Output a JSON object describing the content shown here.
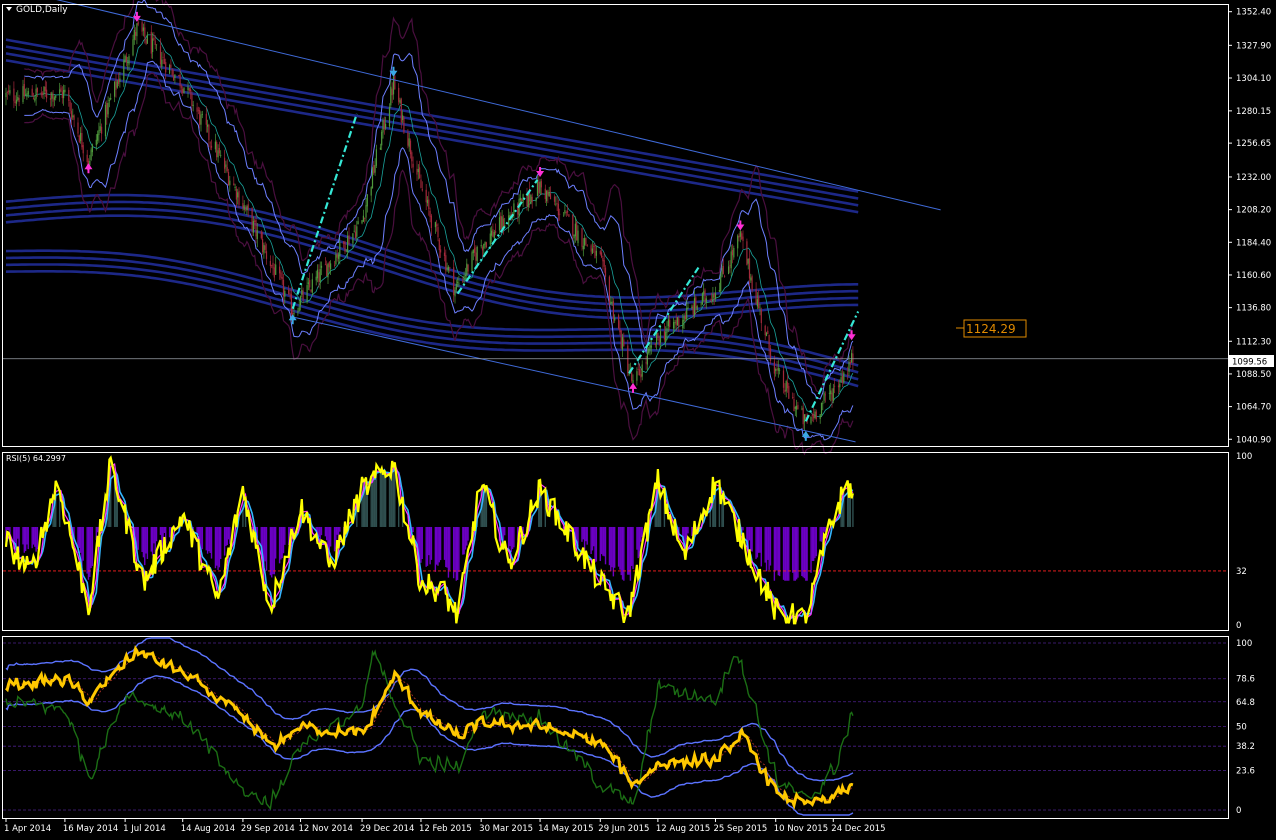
{
  "window": {
    "title": "GOLD,Daily",
    "triangle_icon": "dropdown-triangle-icon"
  },
  "colors": {
    "background": "#000000",
    "frame": "#ffffff",
    "axis_text": "#ffffff",
    "channel_line": "#3f6ad8",
    "envelope_band": "#1f2a8f",
    "bollinger": "#6d7fff",
    "dark_band": "#4a0f3f",
    "candle_up": "#4f9a3c",
    "candle_down": "#a2293b",
    "trend_dash": "#35e8d6",
    "arrow_magenta": "#ff2fd6",
    "arrow_blue": "#3aa9e6",
    "price_label": "#e08a00",
    "rsi_yellow": "#ffff00",
    "rsi_cyan": "#34b6ff",
    "rsi_magenta": "#ff33ff",
    "rsi_hist_purple": "#6b00c4",
    "rsi_hist_gray": "#2f4f4f",
    "rsi_level": "#ff2020",
    "stoch_yellow": "#ffc800",
    "stoch_green": "#1b6e14",
    "stoch_band": "#5b73ff",
    "fib_level": "#4b1f8a"
  },
  "chart_data": [
    {
      "type": "candlestick",
      "title": "GOLD,Daily",
      "xlabel": "",
      "ylabel": "",
      "ylim": [
        1036,
        1358
      ],
      "y_ticks": [
        "1352.40",
        "1327.90",
        "1304.10",
        "1280.15",
        "1256.65",
        "1232.00",
        "1208.20",
        "1184.40",
        "1160.60",
        "1136.80",
        "1112.30",
        "1088.50",
        "1064.70",
        "1040.90"
      ],
      "current_price": "1099.56",
      "annotation_price": "1124.29",
      "x_ticks": [
        "1 Apr 2014",
        "16 May 2014",
        "1 Jul 2014",
        "14 Aug 2014",
        "29 Sep 2014",
        "12 Nov 2014",
        "29 Dec 2014",
        "12 Feb 2015",
        "30 Mar 2015",
        "14 May 2015",
        "29 Jun 2015",
        "12 Aug 2015",
        "25 Sep 2015",
        "10 Nov 2015",
        "24 Dec 2015"
      ],
      "anchors": [
        {
          "date": "1 Apr 2014",
          "close": 1291
        },
        {
          "date": "16 May 2014",
          "close": 1293
        },
        {
          "date": "3 Jun 2014",
          "close": 1244
        },
        {
          "date": "10 Jul 2014",
          "close": 1340
        },
        {
          "date": "14 Aug 2014",
          "close": 1300
        },
        {
          "date": "29 Sep 2014",
          "close": 1212
        },
        {
          "date": "6 Nov 2014",
          "close": 1135
        },
        {
          "date": "29 Dec 2014",
          "close": 1200
        },
        {
          "date": "22 Jan 2015",
          "close": 1300
        },
        {
          "date": "12 Feb 2015",
          "close": 1224
        },
        {
          "date": "10 Mar 2015",
          "close": 1150
        },
        {
          "date": "30 Mar 2015",
          "close": 1183
        },
        {
          "date": "14 May 2015",
          "close": 1225
        },
        {
          "date": "29 Jun 2015",
          "close": 1171
        },
        {
          "date": "24 Jul 2015",
          "close": 1080
        },
        {
          "date": "12 Aug 2015",
          "close": 1115
        },
        {
          "date": "25 Sep 2015",
          "close": 1150
        },
        {
          "date": "14 Oct 2015",
          "close": 1188
        },
        {
          "date": "10 Nov 2015",
          "close": 1090
        },
        {
          "date": "3 Dec 2015",
          "close": 1052
        },
        {
          "date": "24 Dec 2015",
          "close": 1077
        },
        {
          "date": "8 Jan 2016",
          "close": 1099.56
        }
      ],
      "markers": [
        {
          "date": "10 Jul 2014",
          "price": 1345,
          "kind": "down-arrow",
          "color": "magenta"
        },
        {
          "date": "3 Jun 2014",
          "price": 1242,
          "kind": "up-arrow",
          "color": "magenta"
        },
        {
          "date": "6 Nov 2014",
          "price": 1132,
          "kind": "up-arrow",
          "color": "blue"
        },
        {
          "date": "22 Jan 2015",
          "price": 1305,
          "kind": "down-arrow",
          "color": "blue"
        },
        {
          "date": "14 May 2015",
          "price": 1232,
          "kind": "down-arrow",
          "color": "magenta"
        },
        {
          "date": "14 Oct 2015",
          "price": 1193,
          "kind": "down-arrow",
          "color": "magenta"
        },
        {
          "date": "24 Jul 2015",
          "price": 1082,
          "kind": "up-arrow",
          "color": "magenta"
        },
        {
          "date": "3 Dec 2015",
          "price": 1047,
          "kind": "up-arrow",
          "color": "blue"
        },
        {
          "date": "7 Jan 2016",
          "price": 1113,
          "kind": "down-arrow",
          "color": "magenta"
        }
      ],
      "trend_dashes": [
        {
          "from": {
            "date": "6 Nov 2014",
            "price": 1136
          },
          "to": {
            "date": "25 Dec 2014",
            "price": 1278
          }
        },
        {
          "from": {
            "date": "12 Mar 2015",
            "price": 1147
          },
          "to": {
            "date": "12 May 2015",
            "price": 1230
          }
        },
        {
          "from": {
            "date": "21 Jul 2015",
            "price": 1089
          },
          "to": {
            "date": "12 Sep 2015",
            "price": 1166
          }
        },
        {
          "from": {
            "date": "3 Dec 2015",
            "price": 1054
          },
          "to": {
            "date": "12 Jan 2016",
            "price": 1134
          }
        }
      ],
      "channel_lines": [
        {
          "from": {
            "date": "1 Apr 2014",
            "price": 1370
          },
          "to": {
            "date": "15 Mar 2016",
            "price": 1208
          }
        },
        {
          "from": {
            "date": "6 Nov 2014",
            "price": 1130
          },
          "to": {
            "date": "10 Jan 2016",
            "price": 1039
          }
        }
      ]
    },
    {
      "type": "line",
      "title": "RSI(5) 64.2997",
      "ylim": [
        0,
        100
      ],
      "y_ticks": [
        "100",
        "32",
        "0"
      ],
      "level": 32,
      "mid_level": 58,
      "anchors": [
        {
          "date": "1 Apr 2014",
          "value": 50
        },
        {
          "date": "20 Apr 2014",
          "value": 30
        },
        {
          "date": "10 May 2014",
          "value": 85
        },
        {
          "date": "3 Jun 2014",
          "value": 10
        },
        {
          "date": "20 Jun 2014",
          "value": 95
        },
        {
          "date": "15 Jul 2014",
          "value": 25
        },
        {
          "date": "14 Aug 2014",
          "value": 65
        },
        {
          "date": "10 Sep 2014",
          "value": 15
        },
        {
          "date": "29 Sep 2014",
          "value": 80
        },
        {
          "date": "20 Oct 2014",
          "value": 10
        },
        {
          "date": "12 Nov 2014",
          "value": 70
        },
        {
          "date": "5 Dec 2014",
          "value": 35
        },
        {
          "date": "29 Dec 2014",
          "value": 80
        },
        {
          "date": "22 Jan 2015",
          "value": 95
        },
        {
          "date": "12 Feb 2015",
          "value": 25
        },
        {
          "date": "1 Mar 2015",
          "value": 20
        },
        {
          "date": "12 Mar 2015",
          "value": 5
        },
        {
          "date": "30 Mar 2015",
          "value": 85
        },
        {
          "date": "20 Apr 2015",
          "value": 35
        },
        {
          "date": "14 May 2015",
          "value": 80
        },
        {
          "date": "29 Jun 2015",
          "value": 25
        },
        {
          "date": "20 Jul 2015",
          "value": 5
        },
        {
          "date": "12 Aug 2015",
          "value": 85
        },
        {
          "date": "1 Sep 2015",
          "value": 40
        },
        {
          "date": "25 Sep 2015",
          "value": 85
        },
        {
          "date": "10 Nov 2015",
          "value": 8
        },
        {
          "date": "3 Dec 2015",
          "value": 3
        },
        {
          "date": "20 Dec 2015",
          "value": 55
        },
        {
          "date": "4 Jan 2016",
          "value": 85
        },
        {
          "date": "11 Jan 2016",
          "value": 64.3
        }
      ]
    },
    {
      "type": "line",
      "title": "",
      "ylim": [
        -5,
        105
      ],
      "y_ticks": [
        "100",
        "78.6",
        "64.8",
        "50",
        "38.2",
        "23.6",
        "0"
      ],
      "levels": [
        100,
        78.6,
        64.8,
        50,
        38.2,
        23.6,
        0
      ],
      "yellow_anchors": [
        {
          "date": "1 Apr 2014",
          "value": 75
        },
        {
          "date": "16 May 2014",
          "value": 78
        },
        {
          "date": "3 Jun 2014",
          "value": 65
        },
        {
          "date": "1 Jul 2014",
          "value": 90
        },
        {
          "date": "10 Jul 2014",
          "value": 95
        },
        {
          "date": "14 Aug 2014",
          "value": 82
        },
        {
          "date": "29 Sep 2014",
          "value": 55
        },
        {
          "date": "20 Oct 2014",
          "value": 38
        },
        {
          "date": "12 Nov 2014",
          "value": 50
        },
        {
          "date": "29 Dec 2014",
          "value": 45
        },
        {
          "date": "22 Jan 2015",
          "value": 80
        },
        {
          "date": "12 Feb 2015",
          "value": 58
        },
        {
          "date": "12 Mar 2015",
          "value": 44
        },
        {
          "date": "30 Mar 2015",
          "value": 52
        },
        {
          "date": "14 May 2015",
          "value": 50
        },
        {
          "date": "29 Jun 2015",
          "value": 40
        },
        {
          "date": "24 Jul 2015",
          "value": 15
        },
        {
          "date": "12 Aug 2015",
          "value": 28
        },
        {
          "date": "25 Sep 2015",
          "value": 30
        },
        {
          "date": "14 Oct 2015",
          "value": 45
        },
        {
          "date": "10 Nov 2015",
          "value": 10
        },
        {
          "date": "3 Dec 2015",
          "value": 3
        },
        {
          "date": "24 Dec 2015",
          "value": 8
        },
        {
          "date": "11 Jan 2016",
          "value": 15
        }
      ],
      "green_anchors": [
        {
          "date": "1 Apr 2014",
          "value": 65
        },
        {
          "date": "16 May 2014",
          "value": 60
        },
        {
          "date": "3 Jun 2014",
          "value": 20
        },
        {
          "date": "1 Jul 2014",
          "value": 70
        },
        {
          "date": "14 Aug 2014",
          "value": 55
        },
        {
          "date": "29 Sep 2014",
          "value": 10
        },
        {
          "date": "20 Oct 2014",
          "value": 5
        },
        {
          "date": "12 Nov 2014",
          "value": 40
        },
        {
          "date": "29 Dec 2014",
          "value": 60
        },
        {
          "date": "5 Jan 2015",
          "value": 95
        },
        {
          "date": "12 Feb 2015",
          "value": 30
        },
        {
          "date": "12 Mar 2015",
          "value": 25
        },
        {
          "date": "30 Mar 2015",
          "value": 60
        },
        {
          "date": "14 May 2015",
          "value": 55
        },
        {
          "date": "29 Jun 2015",
          "value": 15
        },
        {
          "date": "24 Jul 2015",
          "value": 2
        },
        {
          "date": "12 Aug 2015",
          "value": 75
        },
        {
          "date": "25 Sep 2015",
          "value": 65
        },
        {
          "date": "10 Oct 2015",
          "value": 98
        },
        {
          "date": "10 Nov 2015",
          "value": 18
        },
        {
          "date": "3 Dec 2015",
          "value": 5
        },
        {
          "date": "24 Dec 2015",
          "value": 25
        },
        {
          "date": "11 Jan 2016",
          "value": 64.8
        }
      ]
    }
  ]
}
